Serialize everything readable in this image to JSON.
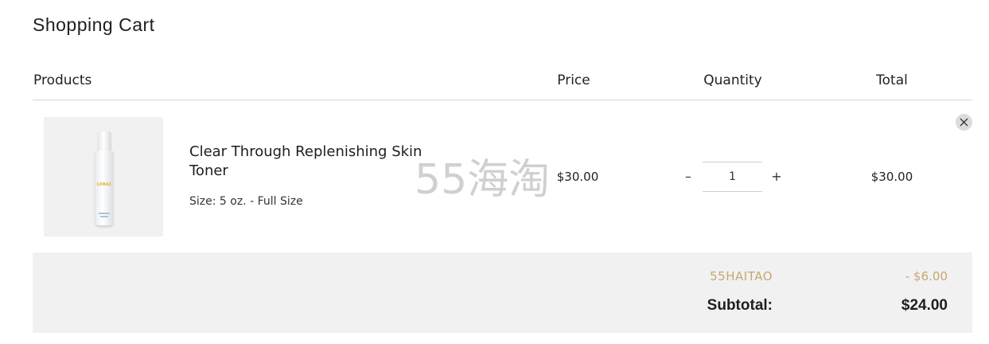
{
  "page": {
    "title": "Shopping Cart"
  },
  "table_header": {
    "products": "Products",
    "price": "Price",
    "quantity": "Quantity",
    "total": "Total"
  },
  "cart_items": [
    {
      "name": "Clear Through Replenishing Skin Toner",
      "variant": "Size: 5 oz. - Full Size",
      "price": "$30.00",
      "quantity": "1",
      "total": "$30.00",
      "image_logo_text": "LORAC",
      "image_icon": "toner-bottle-icon"
    }
  ],
  "controls": {
    "minus": "–",
    "plus": "+",
    "remove_icon": "close-icon"
  },
  "summary": {
    "discount_code": "55HAITAO",
    "discount_amount": "- $6.00",
    "subtotal_label": "Subtotal:",
    "subtotal_value": "$24.00"
  },
  "watermark": {
    "text": "55海淘"
  },
  "colors": {
    "discount_text": "#c6a86f",
    "summary_background": "#f1f1f1",
    "thumbnail_background": "#f1f1f1",
    "divider": "#d8d8d8"
  }
}
